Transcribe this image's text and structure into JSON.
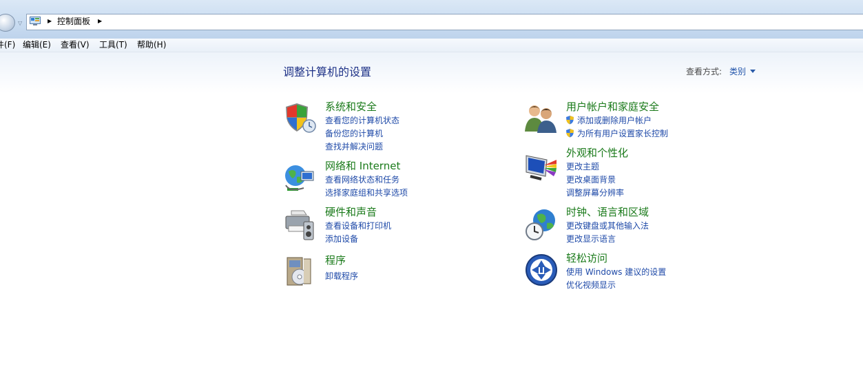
{
  "breadcrumb": {
    "control_panel": "控制面板"
  },
  "menu": [
    {
      "label": "文件(F)",
      "visible": "件(F)"
    },
    {
      "label": "编辑(E)"
    },
    {
      "label": "查看(V)"
    },
    {
      "label": "工具(T)"
    },
    {
      "label": "帮助(H)"
    }
  ],
  "page": {
    "title": "调整计算机的设置",
    "view_by_label": "查看方式:",
    "view_by_value": "类别"
  },
  "categories": {
    "system_security": {
      "title": "系统和安全",
      "icon": "shield-icon",
      "links": [
        "查看您的计算机状态",
        "备份您的计算机",
        "查找并解决问题"
      ]
    },
    "network_internet": {
      "title": "网络和 Internet",
      "icon": "network-globe-icon",
      "links": [
        "查看网络状态和任务",
        "选择家庭组和共享选项"
      ]
    },
    "hardware_sound": {
      "title": "硬件和声音",
      "icon": "printer-icon",
      "links": [
        "查看设备和打印机",
        "添加设备"
      ]
    },
    "programs": {
      "title": "程序",
      "icon": "programs-box-icon",
      "links": [
        "卸载程序"
      ]
    },
    "user_accounts": {
      "title": "用户帐户和家庭安全",
      "icon": "users-icon",
      "links": [
        "添加或删除用户帐户",
        "为所有用户设置家长控制"
      ]
    },
    "appearance": {
      "title": "外观和个性化",
      "icon": "monitor-palette-icon",
      "links": [
        "更改主题",
        "更改桌面背景",
        "调整屏幕分辨率"
      ]
    },
    "clock_region": {
      "title": "时钟、语言和区域",
      "icon": "clock-globe-icon",
      "links": [
        "更改键盘或其他输入法",
        "更改显示语言"
      ]
    },
    "ease_access": {
      "title": "轻松访问",
      "icon": "ease-of-access-icon",
      "links": [
        "使用 Windows 建议的设置",
        "优化视频显示"
      ]
    }
  },
  "colors": {
    "category_title": "#1a7a1a",
    "link": "#1f4aa8",
    "page_title": "#1e3287"
  }
}
